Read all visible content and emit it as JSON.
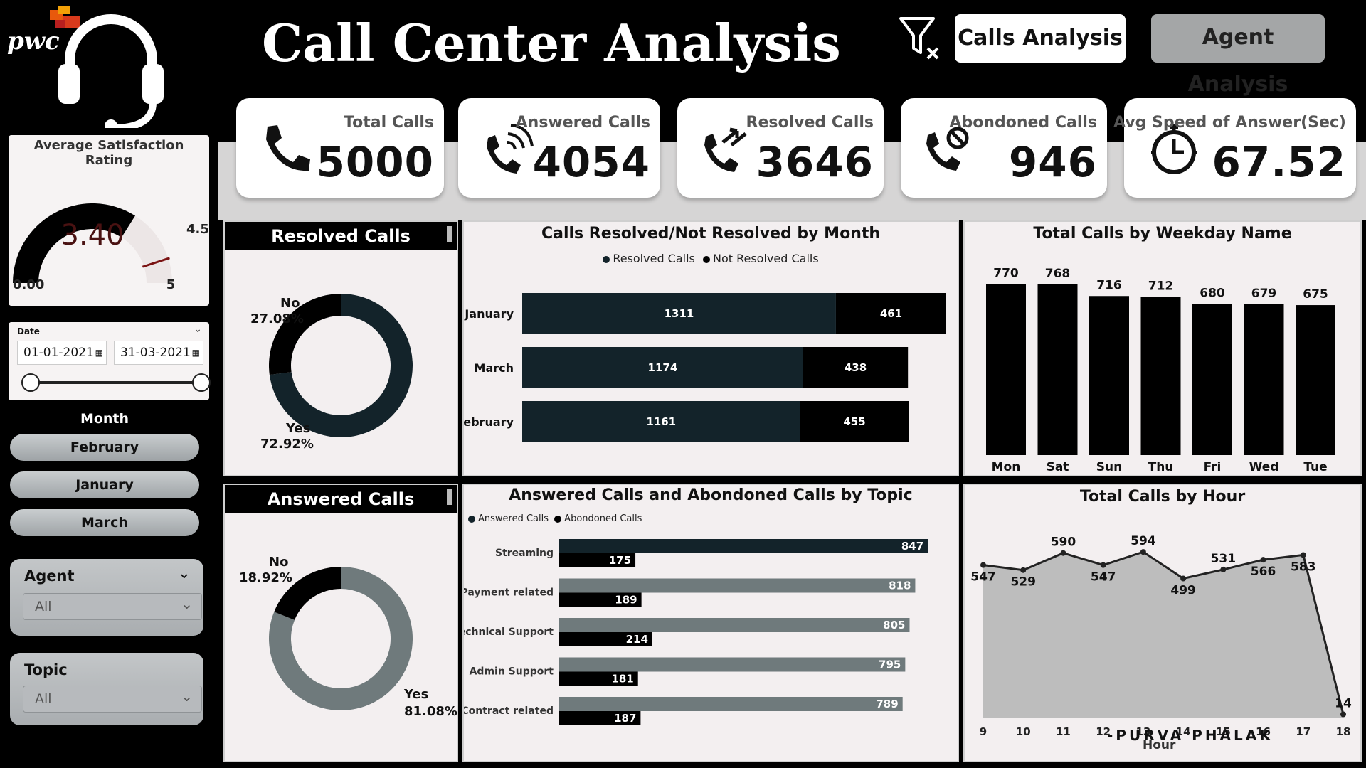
{
  "header": {
    "logo_text": "pwc",
    "title": "Call Center Analysis",
    "clear_filter_icon": "filter-clear-icon",
    "nav": {
      "calls_analysis": "Calls Analysis",
      "agent_analysis": "Agent Analysis"
    }
  },
  "sidebar": {
    "satisfaction": {
      "title": "Average Satisfaction Rating",
      "value": "3.40",
      "min": "0.00",
      "max": "5",
      "target": "4.50",
      "value_num": 3.4,
      "max_num": 5,
      "target_num": 4.5
    },
    "date": {
      "label": "Date",
      "start": "01-01-2021",
      "end": "31-03-2021"
    },
    "month": {
      "label": "Month",
      "items": [
        "February",
        "January",
        "March"
      ]
    },
    "agent": {
      "label": "Agent",
      "value": "All"
    },
    "topic": {
      "label": "Topic",
      "value": "All"
    }
  },
  "kpis": [
    {
      "label": "Total Calls",
      "value": "5000",
      "icon": "phone-icon"
    },
    {
      "label": "Answered Calls",
      "value": "4054",
      "icon": "phone-ringing-icon"
    },
    {
      "label": "Resolved Calls",
      "value": "3646",
      "icon": "phone-forward-icon"
    },
    {
      "label": "Abondoned Calls",
      "value": "946",
      "icon": "phone-blocked-icon"
    },
    {
      "label": "Avg Speed of Answer(Sec)",
      "value": "67.52",
      "icon": "stopwatch-icon"
    }
  ],
  "colors": {
    "dark": "#13232a",
    "black": "#000000",
    "gray": "#6f7a7c",
    "panel": "#f3eff0"
  },
  "resolved_donut": {
    "title": "Resolved Calls",
    "no_label": "No",
    "no_pct": "27.08%",
    "yes_label": "Yes",
    "yes_pct": "72.92%"
  },
  "answered_donut": {
    "title": "Answered Calls",
    "no_label": "No",
    "no_pct": "18.92%",
    "yes_label": "Yes",
    "yes_pct": "81.08%"
  },
  "month_chart": {
    "title": "Calls Resolved/Not Resolved by Month",
    "legend": [
      "Resolved Calls",
      "Not Resolved Calls"
    ]
  },
  "weekday_chart": {
    "title": "Total Calls by Weekday Name"
  },
  "topic_chart": {
    "title": "Answered Calls and Abondoned Calls by Topic",
    "legend": [
      "Answered Calls",
      "Abondoned Calls"
    ]
  },
  "hour_chart": {
    "title": "Total Calls by Hour",
    "xlabel": "Hour"
  },
  "credit": "-PURVA PHALAK",
  "chart_data": [
    {
      "type": "pie",
      "title": "Resolved Calls",
      "categories": [
        "No",
        "Yes"
      ],
      "values": [
        27.08,
        72.92
      ]
    },
    {
      "type": "pie",
      "title": "Answered Calls",
      "categories": [
        "No",
        "Yes"
      ],
      "values": [
        18.92,
        81.08
      ]
    },
    {
      "type": "bar",
      "title": "Calls Resolved/Not Resolved by Month",
      "categories": [
        "January",
        "March",
        "February"
      ],
      "series": [
        {
          "name": "Resolved Calls",
          "values": [
            1311,
            1174,
            1161
          ]
        },
        {
          "name": "Not Resolved Calls",
          "values": [
            461,
            438,
            455
          ]
        }
      ]
    },
    {
      "type": "bar",
      "title": "Total Calls by Weekday Name",
      "categories": [
        "Mon",
        "Sat",
        "Sun",
        "Thu",
        "Fri",
        "Wed",
        "Tue"
      ],
      "values": [
        770,
        768,
        716,
        712,
        680,
        679,
        675
      ]
    },
    {
      "type": "bar",
      "title": "Answered Calls and Abondoned Calls by Topic",
      "categories": [
        "Streaming",
        "Payment related",
        "Technical Support",
        "Admin Support",
        "Contract related"
      ],
      "series": [
        {
          "name": "Answered Calls",
          "values": [
            847,
            818,
            805,
            795,
            789
          ]
        },
        {
          "name": "Abondoned Calls",
          "values": [
            175,
            189,
            214,
            181,
            187
          ]
        }
      ]
    },
    {
      "type": "area",
      "title": "Total Calls by Hour",
      "xlabel": "Hour",
      "x": [
        9,
        10,
        11,
        12,
        13,
        14,
        15,
        16,
        17,
        18
      ],
      "values": [
        547,
        529,
        590,
        547,
        594,
        499,
        531,
        566,
        583,
        14
      ]
    }
  ]
}
